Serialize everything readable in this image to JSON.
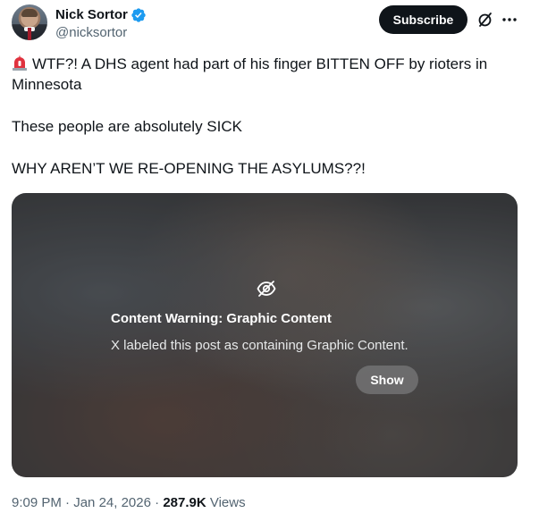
{
  "author": {
    "display_name": "Nick Sortor",
    "handle": "@nicksortor",
    "verified": true
  },
  "header": {
    "subscribe_label": "Subscribe",
    "icons": [
      "grok-icon",
      "more-icon"
    ]
  },
  "post": {
    "lines": [
      "WTF?! A DHS agent had part of his finger BITTEN OFF by rioters in",
      "Minnesota",
      "These people are absolutely SICK",
      "WHY AREN’T WE RE-OPENING THE ASYLUMS??!"
    ],
    "leading_emoji": "siren-icon"
  },
  "media": {
    "warning_title": "Content Warning: Graphic Content",
    "warning_description": "X labeled this post as containing Graphic Content.",
    "show_label": "Show"
  },
  "meta": {
    "time": "9:09 PM",
    "separator": "·",
    "date": "Jan 24, 2026",
    "views_count": "287.9K",
    "views_label": "Views"
  },
  "colors": {
    "text_primary": "#0f1419",
    "text_secondary": "#536471",
    "verified_blue": "#1d9bf0",
    "button_dark": "#0f1419"
  }
}
